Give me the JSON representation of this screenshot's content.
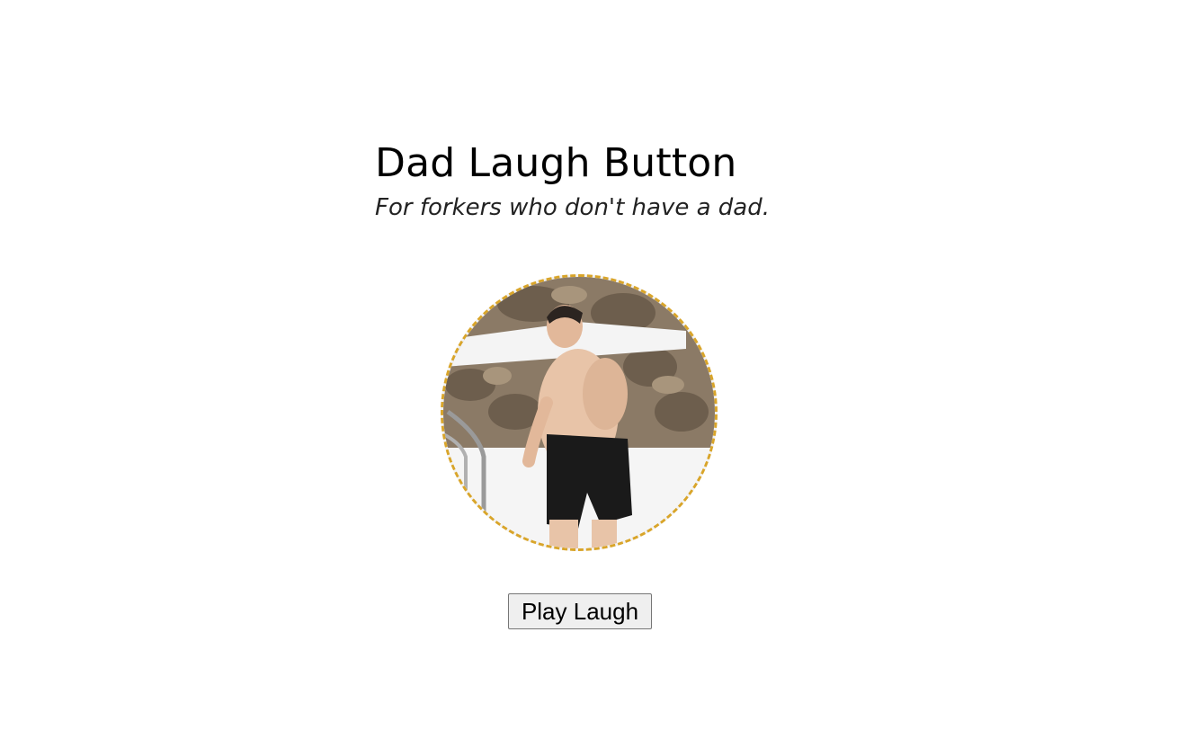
{
  "header": {
    "title": "Dad Laugh Button",
    "subtitle": "For forkers who don't have a dad."
  },
  "avatar": {
    "border_color": "#d9a52a"
  },
  "controls": {
    "play_label": "Play Laugh"
  }
}
